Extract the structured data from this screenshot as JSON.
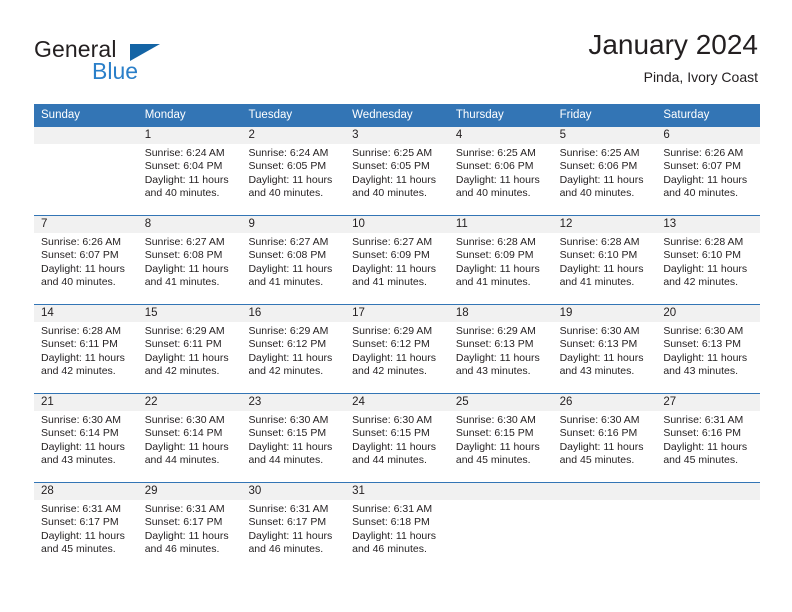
{
  "brand": {
    "word_one": "General",
    "word_two": "Blue",
    "triangle_color": "#1464a5",
    "blue_color": "#2a7fc9"
  },
  "header": {
    "title": "January 2024",
    "subtitle": "Pinda, Ivory Coast"
  },
  "theme": {
    "header_blue": "#3375b5",
    "daynum_band": "#f1f1f1",
    "text": "#231f20"
  },
  "weekdays": [
    "Sunday",
    "Monday",
    "Tuesday",
    "Wednesday",
    "Thursday",
    "Friday",
    "Saturday"
  ],
  "weeks": [
    [
      {
        "day": "",
        "sunrise": "",
        "sunset": "",
        "daylight": ""
      },
      {
        "day": "1",
        "sunrise": "Sunrise: 6:24 AM",
        "sunset": "Sunset: 6:04 PM",
        "daylight": "Daylight: 11 hours and 40 minutes."
      },
      {
        "day": "2",
        "sunrise": "Sunrise: 6:24 AM",
        "sunset": "Sunset: 6:05 PM",
        "daylight": "Daylight: 11 hours and 40 minutes."
      },
      {
        "day": "3",
        "sunrise": "Sunrise: 6:25 AM",
        "sunset": "Sunset: 6:05 PM",
        "daylight": "Daylight: 11 hours and 40 minutes."
      },
      {
        "day": "4",
        "sunrise": "Sunrise: 6:25 AM",
        "sunset": "Sunset: 6:06 PM",
        "daylight": "Daylight: 11 hours and 40 minutes."
      },
      {
        "day": "5",
        "sunrise": "Sunrise: 6:25 AM",
        "sunset": "Sunset: 6:06 PM",
        "daylight": "Daylight: 11 hours and 40 minutes."
      },
      {
        "day": "6",
        "sunrise": "Sunrise: 6:26 AM",
        "sunset": "Sunset: 6:07 PM",
        "daylight": "Daylight: 11 hours and 40 minutes."
      }
    ],
    [
      {
        "day": "7",
        "sunrise": "Sunrise: 6:26 AM",
        "sunset": "Sunset: 6:07 PM",
        "daylight": "Daylight: 11 hours and 40 minutes."
      },
      {
        "day": "8",
        "sunrise": "Sunrise: 6:27 AM",
        "sunset": "Sunset: 6:08 PM",
        "daylight": "Daylight: 11 hours and 41 minutes."
      },
      {
        "day": "9",
        "sunrise": "Sunrise: 6:27 AM",
        "sunset": "Sunset: 6:08 PM",
        "daylight": "Daylight: 11 hours and 41 minutes."
      },
      {
        "day": "10",
        "sunrise": "Sunrise: 6:27 AM",
        "sunset": "Sunset: 6:09 PM",
        "daylight": "Daylight: 11 hours and 41 minutes."
      },
      {
        "day": "11",
        "sunrise": "Sunrise: 6:28 AM",
        "sunset": "Sunset: 6:09 PM",
        "daylight": "Daylight: 11 hours and 41 minutes."
      },
      {
        "day": "12",
        "sunrise": "Sunrise: 6:28 AM",
        "sunset": "Sunset: 6:10 PM",
        "daylight": "Daylight: 11 hours and 41 minutes."
      },
      {
        "day": "13",
        "sunrise": "Sunrise: 6:28 AM",
        "sunset": "Sunset: 6:10 PM",
        "daylight": "Daylight: 11 hours and 42 minutes."
      }
    ],
    [
      {
        "day": "14",
        "sunrise": "Sunrise: 6:28 AM",
        "sunset": "Sunset: 6:11 PM",
        "daylight": "Daylight: 11 hours and 42 minutes."
      },
      {
        "day": "15",
        "sunrise": "Sunrise: 6:29 AM",
        "sunset": "Sunset: 6:11 PM",
        "daylight": "Daylight: 11 hours and 42 minutes."
      },
      {
        "day": "16",
        "sunrise": "Sunrise: 6:29 AM",
        "sunset": "Sunset: 6:12 PM",
        "daylight": "Daylight: 11 hours and 42 minutes."
      },
      {
        "day": "17",
        "sunrise": "Sunrise: 6:29 AM",
        "sunset": "Sunset: 6:12 PM",
        "daylight": "Daylight: 11 hours and 42 minutes."
      },
      {
        "day": "18",
        "sunrise": "Sunrise: 6:29 AM",
        "sunset": "Sunset: 6:13 PM",
        "daylight": "Daylight: 11 hours and 43 minutes."
      },
      {
        "day": "19",
        "sunrise": "Sunrise: 6:30 AM",
        "sunset": "Sunset: 6:13 PM",
        "daylight": "Daylight: 11 hours and 43 minutes."
      },
      {
        "day": "20",
        "sunrise": "Sunrise: 6:30 AM",
        "sunset": "Sunset: 6:13 PM",
        "daylight": "Daylight: 11 hours and 43 minutes."
      }
    ],
    [
      {
        "day": "21",
        "sunrise": "Sunrise: 6:30 AM",
        "sunset": "Sunset: 6:14 PM",
        "daylight": "Daylight: 11 hours and 43 minutes."
      },
      {
        "day": "22",
        "sunrise": "Sunrise: 6:30 AM",
        "sunset": "Sunset: 6:14 PM",
        "daylight": "Daylight: 11 hours and 44 minutes."
      },
      {
        "day": "23",
        "sunrise": "Sunrise: 6:30 AM",
        "sunset": "Sunset: 6:15 PM",
        "daylight": "Daylight: 11 hours and 44 minutes."
      },
      {
        "day": "24",
        "sunrise": "Sunrise: 6:30 AM",
        "sunset": "Sunset: 6:15 PM",
        "daylight": "Daylight: 11 hours and 44 minutes."
      },
      {
        "day": "25",
        "sunrise": "Sunrise: 6:30 AM",
        "sunset": "Sunset: 6:15 PM",
        "daylight": "Daylight: 11 hours and 45 minutes."
      },
      {
        "day": "26",
        "sunrise": "Sunrise: 6:30 AM",
        "sunset": "Sunset: 6:16 PM",
        "daylight": "Daylight: 11 hours and 45 minutes."
      },
      {
        "day": "27",
        "sunrise": "Sunrise: 6:31 AM",
        "sunset": "Sunset: 6:16 PM",
        "daylight": "Daylight: 11 hours and 45 minutes."
      }
    ],
    [
      {
        "day": "28",
        "sunrise": "Sunrise: 6:31 AM",
        "sunset": "Sunset: 6:17 PM",
        "daylight": "Daylight: 11 hours and 45 minutes."
      },
      {
        "day": "29",
        "sunrise": "Sunrise: 6:31 AM",
        "sunset": "Sunset: 6:17 PM",
        "daylight": "Daylight: 11 hours and 46 minutes."
      },
      {
        "day": "30",
        "sunrise": "Sunrise: 6:31 AM",
        "sunset": "Sunset: 6:17 PM",
        "daylight": "Daylight: 11 hours and 46 minutes."
      },
      {
        "day": "31",
        "sunrise": "Sunrise: 6:31 AM",
        "sunset": "Sunset: 6:18 PM",
        "daylight": "Daylight: 11 hours and 46 minutes."
      },
      {
        "day": "",
        "sunrise": "",
        "sunset": "",
        "daylight": ""
      },
      {
        "day": "",
        "sunrise": "",
        "sunset": "",
        "daylight": ""
      },
      {
        "day": "",
        "sunrise": "",
        "sunset": "",
        "daylight": ""
      }
    ]
  ]
}
